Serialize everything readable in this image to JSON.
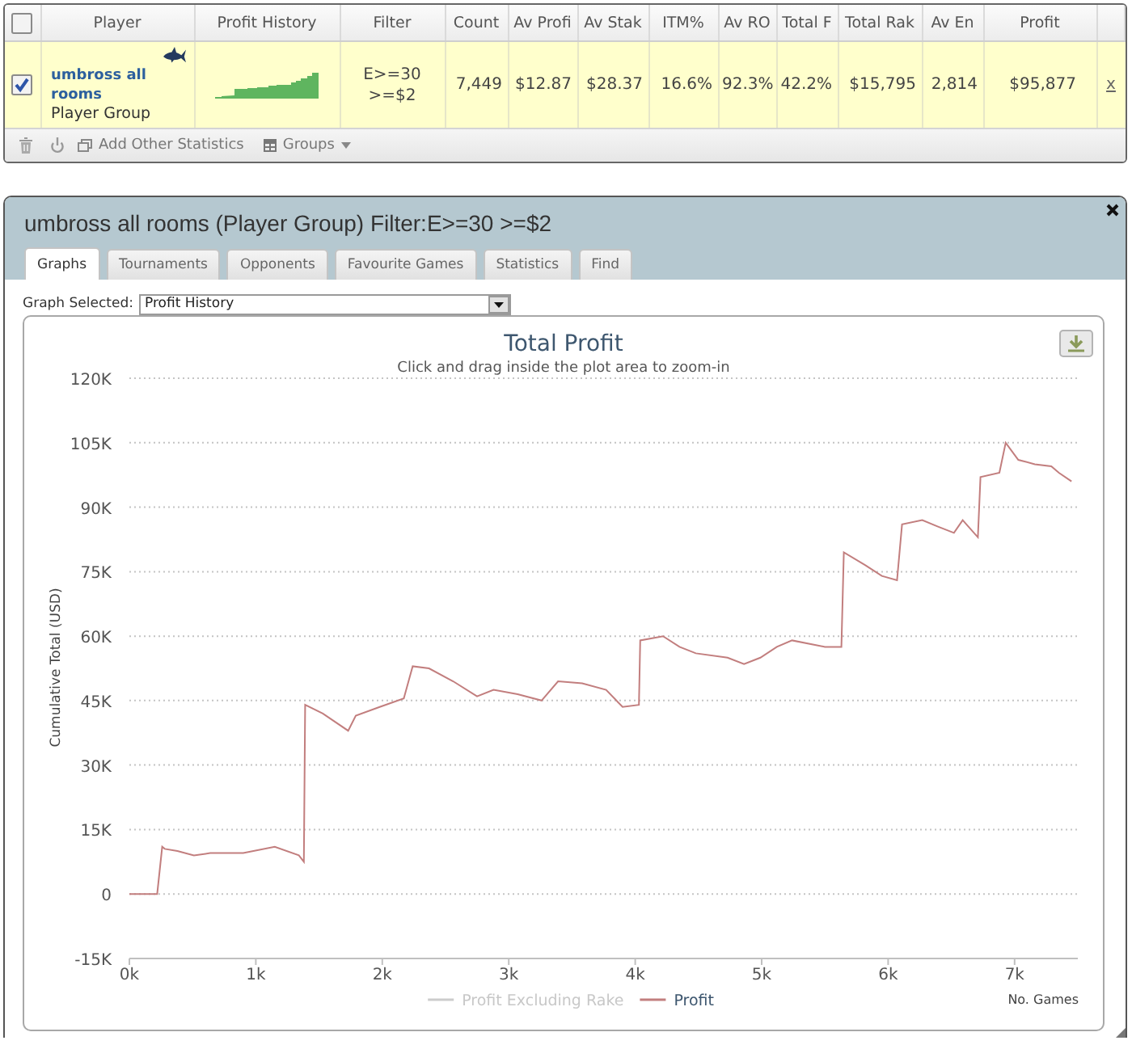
{
  "stats_table": {
    "select_all": {
      "checked": false
    },
    "columns": [
      "Player",
      "Profit History",
      "Filter",
      "Count",
      "Av Profi",
      "Av Stak",
      "ITM%",
      "Av RO",
      "Total F",
      "Total Rak",
      "Av En",
      "Profit"
    ],
    "rows": [
      {
        "selected": true,
        "checked": true,
        "cells": [
          {
            "kind": "player",
            "name": "umbross all rooms",
            "type": "Player Group"
          },
          {
            "kind": "sparkline"
          },
          {
            "kind": "lines",
            "lines": [
              "E>=30",
              ">=$2"
            ]
          },
          "7,449",
          "$12.87",
          "$28.37",
          "16.6%",
          "92.3%",
          "42.2%",
          "$15,795",
          "2,814",
          "$95,877"
        ],
        "remove": "x"
      }
    ],
    "toolbar": {
      "add_statistics": "Add Other Statistics",
      "groups": "Groups"
    }
  },
  "panel": {
    "title": "umbross all rooms (Player Group) Filter:E>=30 >=$2",
    "tabs": [
      {
        "label": "Graphs",
        "selected": true
      },
      {
        "label": "Tournaments",
        "selected": false
      },
      {
        "label": "Opponents",
        "selected": false
      },
      {
        "label": "Favourite Games",
        "selected": false
      },
      {
        "label": "Statistics",
        "selected": false
      },
      {
        "label": "Find",
        "selected": false
      }
    ],
    "graph_selector": {
      "label": "Graph Selected:",
      "value": "Profit History"
    },
    "chart": {
      "subtitle": "Click and drag inside the plot area to zoom-in",
      "legend_items": [
        {
          "label": "Profit Excluding Rake",
          "active": false
        }
      ],
      "chart_data": {
        "type": "line",
        "title": "Total Profit",
        "xlabel": "No. Games",
        "ylabel": "Cumulative Total (USD)",
        "x": [
          0,
          220,
          260,
          280,
          380,
          510,
          640,
          900,
          1150,
          1340,
          1380,
          1390,
          1530,
          1730,
          1790,
          1980,
          2170,
          2240,
          2370,
          2560,
          2750,
          2880,
          3070,
          3260,
          3390,
          3580,
          3770,
          3900,
          4030,
          4040,
          4220,
          4350,
          4480,
          4730,
          4860,
          4990,
          5120,
          5240,
          5500,
          5630,
          5650,
          5820,
          5950,
          6070,
          6110,
          6270,
          6390,
          6520,
          6590,
          6710,
          6730,
          6880,
          6930,
          7030,
          7160,
          7290,
          7350,
          7450
        ],
        "series": [
          {
            "name": "Profit",
            "color": "#c27e7e",
            "values": [
              0,
              0,
              11000,
              10500,
              10000,
              9000,
              9500,
              9500,
              11000,
              9000,
              7500,
              44000,
              42000,
              38000,
              41500,
              43500,
              45500,
              53000,
              52500,
              49500,
              46000,
              47500,
              46500,
              45000,
              49500,
              49000,
              47500,
              43500,
              44000,
              59000,
              60000,
              57500,
              56000,
              55000,
              53500,
              55000,
              57500,
              59000,
              57500,
              57500,
              79500,
              76500,
              74000,
              73000,
              86000,
              87000,
              85500,
              84000,
              87000,
              83000,
              97000,
              98000,
              105000,
              101000,
              100000,
              99500,
              98000,
              96000
            ]
          }
        ],
        "xlim": [
          0,
          7500
        ],
        "ylim": [
          -15000,
          120000
        ],
        "grid": true,
        "xticks": [
          {
            "value": 0,
            "label": "0k"
          },
          {
            "value": 1000,
            "label": "1k"
          },
          {
            "value": 2000,
            "label": "2k"
          },
          {
            "value": 3000,
            "label": "3k"
          },
          {
            "value": 4000,
            "label": "4k"
          },
          {
            "value": 5000,
            "label": "5k"
          },
          {
            "value": 6000,
            "label": "6k"
          },
          {
            "value": 7000,
            "label": "7k"
          }
        ],
        "yticks": [
          {
            "value": -15000,
            "label": "-15K"
          },
          {
            "value": 0,
            "label": "0"
          },
          {
            "value": 15000,
            "label": "15K"
          },
          {
            "value": 30000,
            "label": "30K"
          },
          {
            "value": 45000,
            "label": "45K"
          },
          {
            "value": 60000,
            "label": "60K"
          },
          {
            "value": 75000,
            "label": "75K"
          },
          {
            "value": 90000,
            "label": "90K"
          },
          {
            "value": 105000,
            "label": "105K"
          },
          {
            "value": 120000,
            "label": "120K"
          }
        ]
      }
    }
  }
}
